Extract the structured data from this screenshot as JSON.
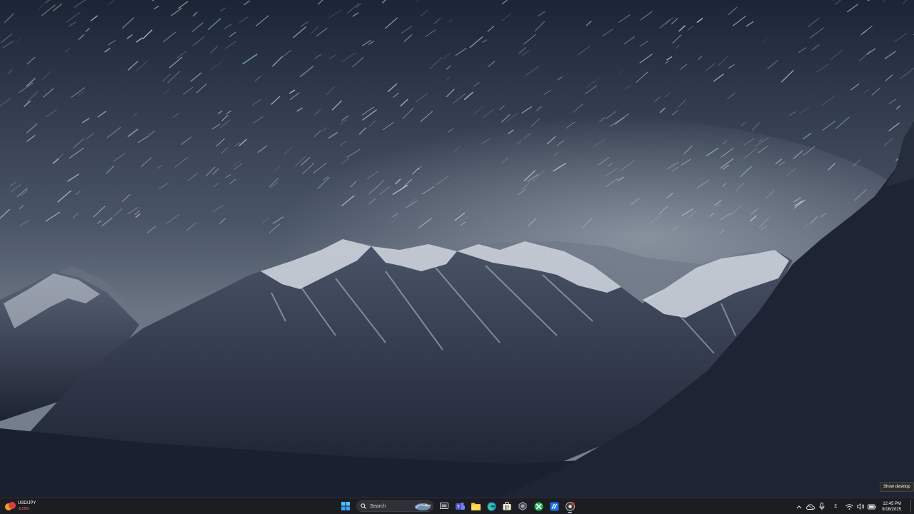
{
  "widget": {
    "pair": "USD/JPY",
    "change": "-0.55%"
  },
  "search": {
    "label": "Search"
  },
  "taskbar": {
    "apps": [
      "start",
      "search",
      "task-view",
      "teams",
      "file-explorer",
      "edge",
      "store",
      "copilot",
      "xbox",
      "vscode",
      "chrome"
    ]
  },
  "tray": {
    "input_indicator": "£",
    "time": "12:45 PM",
    "date": "9/16/2025"
  },
  "tooltip": {
    "text": "Show desktop"
  },
  "colors": {
    "taskbar_bg": "#1c1d22",
    "accent_blue": "#3aa0ff",
    "xbox_green": "#1db954"
  }
}
